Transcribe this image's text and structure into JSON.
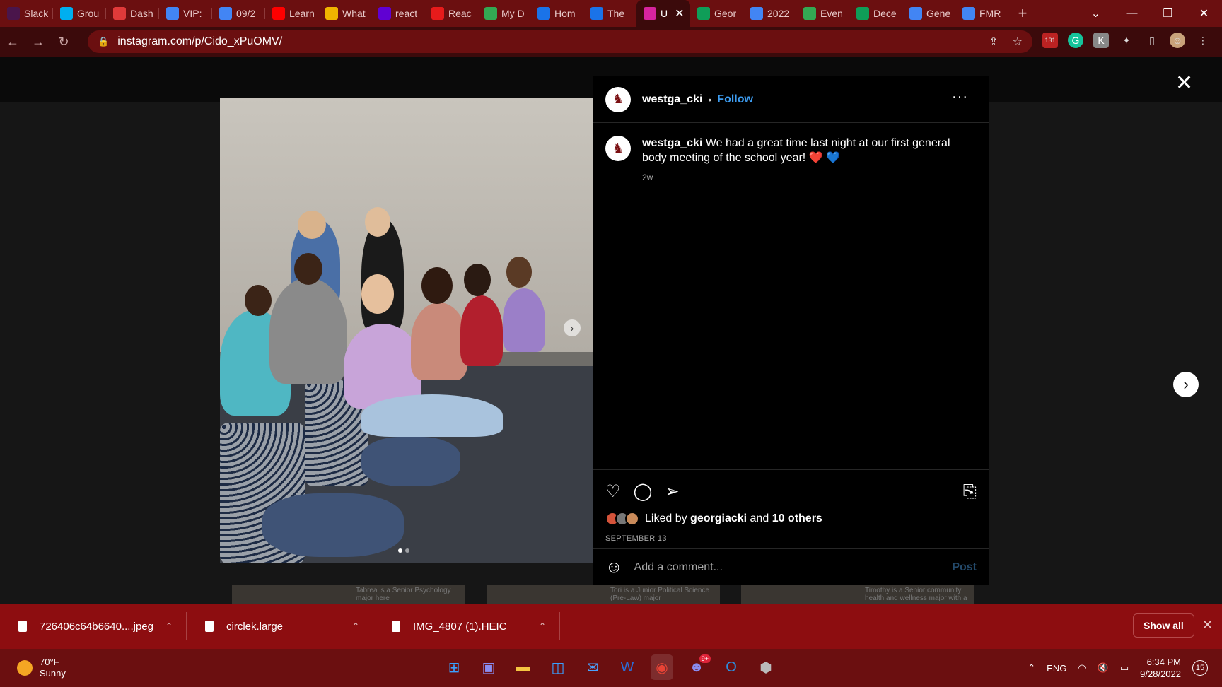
{
  "tabs": [
    {
      "label": "Slack",
      "icon": "slack-icon",
      "color": "#4a154b"
    },
    {
      "label": "Grou",
      "icon": "groupme-icon",
      "color": "#00aff0"
    },
    {
      "label": "Dash",
      "icon": "dashboard-icon",
      "color": "#e03a3a"
    },
    {
      "label": "VIP:",
      "icon": "docs-icon",
      "color": "#4285f4"
    },
    {
      "label": "09/2",
      "icon": "docs-icon",
      "color": "#4285f4"
    },
    {
      "label": "Learn",
      "icon": "youtube-icon",
      "color": "#ff0000"
    },
    {
      "label": "What",
      "icon": "circle-icon",
      "color": "#f0b400"
    },
    {
      "label": "react",
      "icon": "yahoo-icon",
      "color": "#6001d2"
    },
    {
      "label": "Reac",
      "icon": "vivaldi-icon",
      "color": "#e61b1b"
    },
    {
      "label": "My D",
      "icon": "drive-icon",
      "color": "#34a853"
    },
    {
      "label": "Hom",
      "icon": "c-icon",
      "color": "#1a73e8"
    },
    {
      "label": "The",
      "icon": "c-icon",
      "color": "#1a73e8"
    },
    {
      "label": "U",
      "icon": "instagram-icon",
      "color": "#d6249f",
      "active": true
    },
    {
      "label": "Geor",
      "icon": "classroom-icon",
      "color": "#0f9d58"
    },
    {
      "label": "2022",
      "icon": "docs-icon",
      "color": "#4285f4"
    },
    {
      "label": "Even",
      "icon": "drive-icon",
      "color": "#34a853"
    },
    {
      "label": "Dece",
      "icon": "sheets-icon",
      "color": "#0f9d58"
    },
    {
      "label": "Gene",
      "icon": "docs-icon",
      "color": "#4285f4"
    },
    {
      "label": "FMR",
      "icon": "docs-icon",
      "color": "#4285f4"
    }
  ],
  "address": {
    "url": "instagram.com/p/Cido_xPuOMV/"
  },
  "extensions": {
    "badge_count": "131"
  },
  "post": {
    "username": "westga_cki",
    "follow_label": "Follow",
    "separator": "•",
    "caption": "We had a great time last night at our first general body meeting of the school year!",
    "caption_emoji": "❤️ 💙",
    "time_ago": "2w",
    "liked_by_prefix": "Liked by",
    "liked_by_user": "georgiacki",
    "liked_by_and": "and",
    "liked_by_others": "10 others",
    "date": "SEPTEMBER 13",
    "comment_placeholder": "Add a comment...",
    "post_label": "Post",
    "slide_count": 2,
    "active_slide": 1
  },
  "thumbnails": [
    {
      "text": "Tabrea is a Senior Psychology major here"
    },
    {
      "text": "Tori is a Junior Political Science (Pre-Law) major"
    },
    {
      "text": "Timothy is a Senior community health and wellness major with a"
    }
  ],
  "downloads": [
    {
      "name": "726406c64b6640....jpeg"
    },
    {
      "name": "circlek.large"
    },
    {
      "name": "IMG_4807 (1).HEIC"
    }
  ],
  "download_bar": {
    "show_all": "Show all"
  },
  "taskbar": {
    "temp": "70°F",
    "condition": "Sunny",
    "lang": "ENG",
    "time": "6:34 PM",
    "date": "9/28/2022",
    "notif_count": "15",
    "discord_badge": "9+"
  }
}
